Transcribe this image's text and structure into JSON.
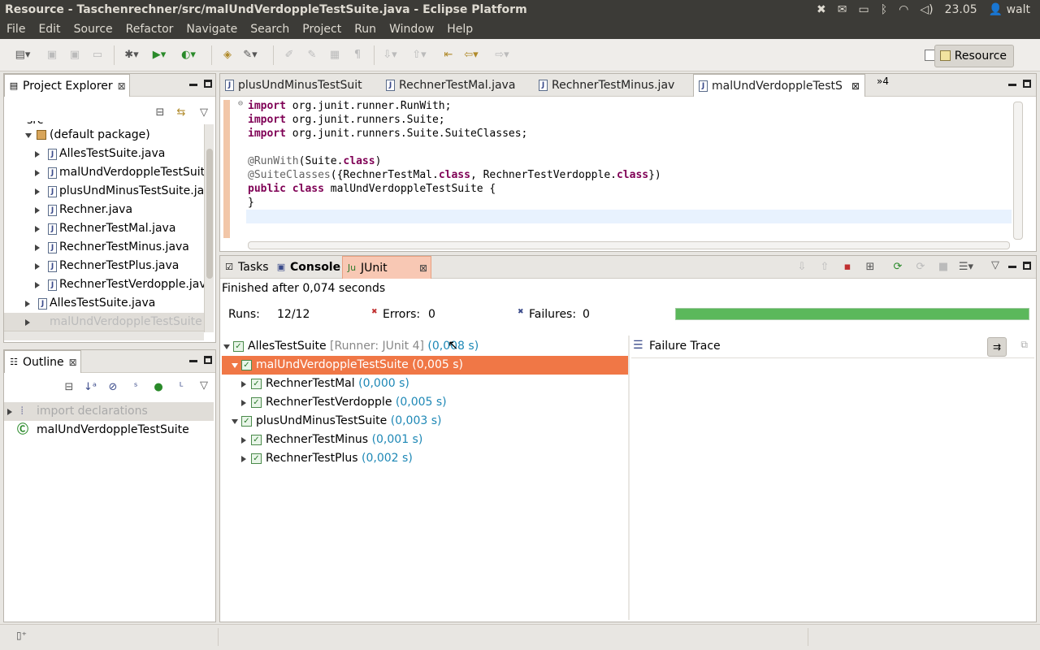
{
  "window": {
    "title": "Resource - Taschenrechner/src/malUndVerdoppleTestSuite.java - Eclipse Platform"
  },
  "system": {
    "clock": "23.05",
    "user": "walt"
  },
  "menu": {
    "items": [
      "File",
      "Edit",
      "Source",
      "Refactor",
      "Navigate",
      "Search",
      "Project",
      "Run",
      "Window",
      "Help"
    ]
  },
  "toolbar": {
    "perspective_label": "Resource"
  },
  "project_explorer": {
    "tab_label": "Project Explorer",
    "src_label": "src",
    "default_package": "(default package)",
    "files": [
      "AllesTestSuite.java",
      "malUndVerdoppleTestSuit",
      "plusUndMinusTestSuite.jav",
      "Rechner.java",
      "RechnerTestMal.java",
      "RechnerTestMinus.java",
      "RechnerTestPlus.java",
      "RechnerTestVerdopple.jav"
    ],
    "root_file": "AllesTestSuite.java",
    "partial_item": "malUndVerdoppleTestSuite"
  },
  "outline": {
    "tab_label": "Outline",
    "imports_label": "import declarations",
    "class_label": "malUndVerdoppleTestSuite"
  },
  "editor": {
    "tabs": [
      "plusUndMinusTestSuit",
      "RechnerTestMal.java",
      "RechnerTestMinus.jav",
      "malUndVerdoppleTestS"
    ],
    "overflow": "»4",
    "code": {
      "l1_kw": "import",
      "l1_rest": " org.junit.runner.RunWith;",
      "l2_kw": "import",
      "l2_rest": " org.junit.runners.Suite;",
      "l3_kw": "import",
      "l3_rest": " org.junit.runners.Suite.SuiteClasses;",
      "l5_ann": "@RunWith",
      "l5_a": "(Suite.",
      "l5_kw": "class",
      "l5_b": ")",
      "l6_ann": "@SuiteClasses",
      "l6_a": "({RechnerTestMal.",
      "l6_kw1": "class",
      "l6_b": ", RechnerTestVerdopple.",
      "l6_kw2": "class",
      "l6_c": "})",
      "l7_kw1": "public",
      "l7_kw2": "class",
      "l7_rest": " malUndVerdoppleTestSuite {",
      "l8": "}"
    }
  },
  "bottom_tabs": {
    "tasks": "Tasks",
    "console": "Console",
    "junit": "JUnit"
  },
  "junit": {
    "finished": "Finished after 0,074 seconds",
    "runs_label": "Runs:",
    "runs_value": "12/12",
    "errors_label": "Errors:",
    "errors_value": "0",
    "failures_label": "Failures:",
    "failures_value": "0",
    "progress": 1.0,
    "failure_trace_label": "Failure Trace",
    "tree": [
      {
        "name": "AllesTestSuite",
        "runner": "[Runner: JUnit 4]",
        "time": "(0,008 s)"
      },
      {
        "name": "malUndVerdoppleTestSuite",
        "time": "(0,005 s)"
      },
      {
        "name": "RechnerTestMal",
        "time": "(0,000 s)"
      },
      {
        "name": "RechnerTestVerdopple",
        "time": "(0,005 s)"
      },
      {
        "name": "plusUndMinusTestSuite",
        "time": "(0,003 s)"
      },
      {
        "name": "RechnerTestMinus",
        "time": "(0,001 s)"
      },
      {
        "name": "RechnerTestPlus",
        "time": "(0,002 s)"
      }
    ]
  },
  "colors": {
    "progress_green": "#5bb85b",
    "selection": "#f07746",
    "time_blue": "#1e88b6"
  }
}
